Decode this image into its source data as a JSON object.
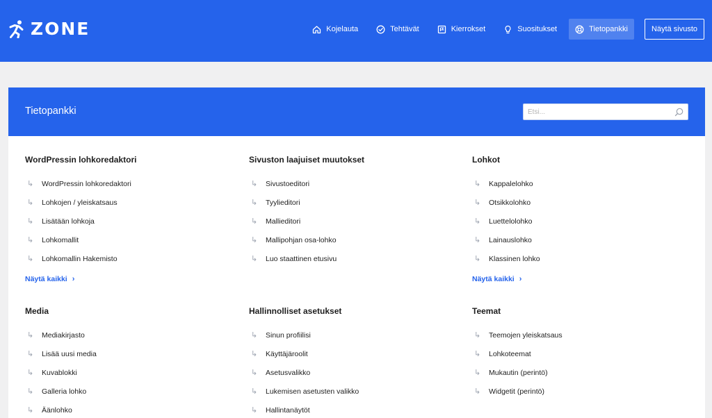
{
  "brand": {
    "name": "ZONE"
  },
  "nav": {
    "items": [
      {
        "label": "Kojelauta",
        "icon": "home-icon"
      },
      {
        "label": "Tehtävät",
        "icon": "check-circle-icon"
      },
      {
        "label": "Kierrokset",
        "icon": "tour-icon"
      },
      {
        "label": "Suositukset",
        "icon": "lightbulb-icon"
      },
      {
        "label": "Tietopankki",
        "icon": "lifebuoy-icon",
        "active": true
      }
    ],
    "button": "Näytä sivusto"
  },
  "panel": {
    "title": "Tietopankki",
    "search_placeholder": "Etsi..."
  },
  "sections": [
    {
      "title": "WordPressin lohkoredaktori",
      "items": [
        "WordPressin lohkoredaktori",
        "Lohkojen / yleiskatsaus",
        "Lisätään lohkoja",
        "Lohkomallit",
        "Lohkomallin Hakemisto"
      ],
      "show_all": "Näytä kaikki"
    },
    {
      "title": "Sivuston laajuiset muutokset",
      "items": [
        "Sivustoeditori",
        "Tyylieditori",
        "Mallieditori",
        "Mallipohjan osa-lohko",
        "Luo staattinen etusivu"
      ]
    },
    {
      "title": "Lohkot",
      "items": [
        "Kappalelohko",
        "Otsikkolohko",
        "Luettelolohko",
        "Lainauslohko",
        "Klassinen lohko"
      ],
      "show_all": "Näytä kaikki"
    },
    {
      "title": "Media",
      "items": [
        "Mediakirjasto",
        "Lisää uusi media",
        "Kuvablokki",
        "Galleria lohko",
        "Äänlohko"
      ]
    },
    {
      "title": "Hallinnolliset asetukset",
      "items": [
        "Sinun profiilisi",
        "Käyttäjäroolit",
        "Asetusvalikko",
        "Lukemisen asetusten valikko",
        "Hallintanäytöt"
      ]
    },
    {
      "title": "Teemat",
      "items": [
        "Teemojen yleiskatsaus",
        "Lohkoteemat",
        "Mukautin (perintö)",
        "Widgetit (perintö)"
      ]
    }
  ],
  "colors": {
    "accent": "#2563eb",
    "background": "#f0f0f1",
    "panel": "#ffffff"
  }
}
